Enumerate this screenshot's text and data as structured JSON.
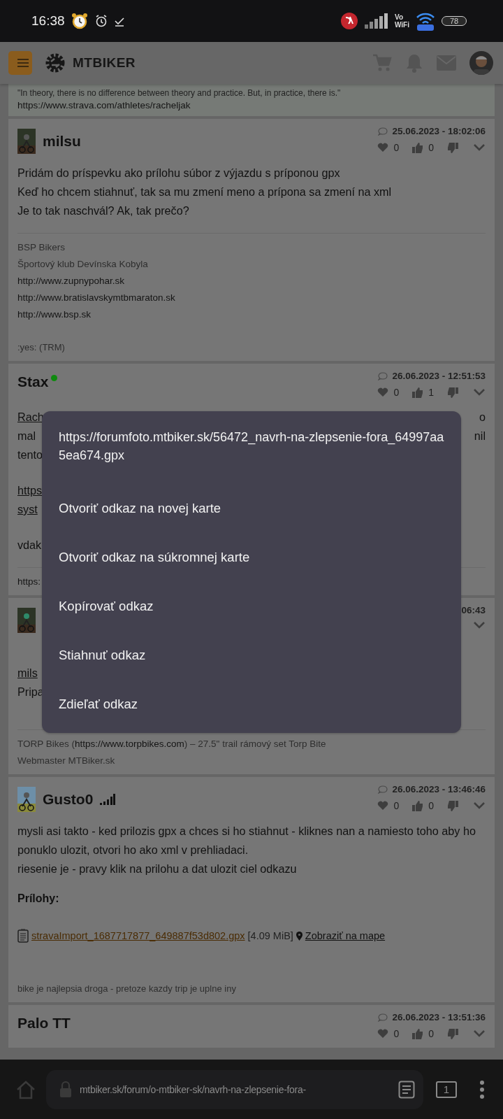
{
  "status_bar": {
    "time": "16:38",
    "vowifi": [
      "Vo",
      "WiFi"
    ],
    "battery": "78"
  },
  "header": {
    "logo": "MTBIKER"
  },
  "top_card": {
    "quote": "\"In theory, there is no difference between theory and practice. But, in practice, there is.\"",
    "link": "https://www.strava.com/athletes/racheljak"
  },
  "posts": [
    {
      "author": "milsu",
      "avatar": true,
      "online": false,
      "rank": false,
      "date": "25.06.2023 - 18:02:06",
      "hearts": "0",
      "thumbs": "0",
      "body": [
        [
          {
            "text": "Pridám do príspevku ako prílohu súbor z výjazdu s príponou gpx"
          },
          {
            "text": "Keď ho chcem stiahnuť, tak sa mu zmení meno a prípona sa zmení na xml"
          },
          {
            "text": "Je to tak naschvál? Ak, tak prečo?"
          }
        ]
      ],
      "signature": [
        [
          {
            "text": "BSP Bikers",
            "kind": "muted"
          }
        ],
        [
          {
            "text": "Športový klub Devínska Kobyla",
            "kind": "muted"
          }
        ],
        [
          {
            "text": "http://www.zupnypohar.sk",
            "kind": "url"
          }
        ],
        [
          {
            "text": "http://www.bratislavskymtbmaraton.sk",
            "kind": "url"
          }
        ],
        [
          {
            "text": "http://www.bsp.sk",
            "kind": "url"
          }
        ]
      ],
      "footer": ":yes: (TRM)"
    },
    {
      "author": "Stax",
      "avatar": false,
      "online": true,
      "rank": false,
      "date": "26.06.2023 - 12:51:53",
      "hearts": "0",
      "thumbs": "1",
      "body": [
        [
          {
            "text": "Rach",
            "link": true,
            "right": "o"
          },
          {
            "text": "mal",
            "right": "nil"
          },
          {
            "text": "tento"
          }
        ],
        [
          {
            "text": "https",
            "link": true
          },
          {
            "text": "syst",
            "link": true
          }
        ],
        [
          {
            "text": "vdak"
          }
        ]
      ],
      "signature": [
        [
          {
            "text": "https:",
            "kind": "url"
          }
        ]
      ]
    },
    {
      "avatar": true,
      "online": false,
      "rank": false,
      "date": "06:43",
      "body": [
        [
          {
            "text": "mils",
            "link": true
          },
          {
            "text": "Pripa"
          }
        ]
      ],
      "signature": [
        [
          {
            "text": "TORP Bikes (",
            "kind": "muted"
          },
          {
            "text": "https://www.torpbikes.com",
            "kind": "url"
          },
          {
            "text": ") – 27.5\" trail rámový set Torp Bite",
            "kind": "muted"
          }
        ],
        [
          {
            "text": "Webmaster MTBiker.sk",
            "kind": "muted"
          }
        ]
      ]
    },
    {
      "author": "Gusto0",
      "avatar": true,
      "online": false,
      "rank": true,
      "date": "26.06.2023 - 13:46:46",
      "hearts": "0",
      "thumbs": "0",
      "body": [
        [
          {
            "text": "mysli asi takto - ked prilozis gpx a chces si ho stiahnut - kliknes nan a namiesto toho aby ho ponuklo ulozit, otvori ho ako xml v prehliadaci."
          },
          {
            "text": "riesenie je - pravy klik na prilohu a dat ulozit ciel odkazu"
          }
        ]
      ],
      "attachments_title": "Prílohy:",
      "attachments": [
        {
          "file": "stravaImport_1687717877_649887f53d802.gpx",
          "size": "[4.09 MiB]",
          "map": "Zobraziť na mape"
        }
      ],
      "footer": "bike je najlepsia droga - pretoze kazdy trip je uplne iny"
    },
    {
      "author": "Palo TT",
      "avatar": false,
      "online": false,
      "rank": false,
      "date": "26.06.2023 - 13:51:36",
      "hearts": "0",
      "thumbs": "0"
    }
  ],
  "context_menu": {
    "url": "https://forumfoto.mtbiker.sk/56472_navrh-na-zlepsenie-fora_64997aa5ea674.gpx",
    "items": [
      "Otvoriť odkaz na novej karte",
      "Otvoriť odkaz na súkromnej karte",
      "Kopírovať odkaz",
      "Stiahnuť odkaz",
      "Zdieľať odkaz"
    ]
  },
  "browser_bar": {
    "url": "mtbiker.sk/forum/o-mtbiker-sk/navrh-na-zlepsenie-fora-",
    "tabs": "1"
  }
}
